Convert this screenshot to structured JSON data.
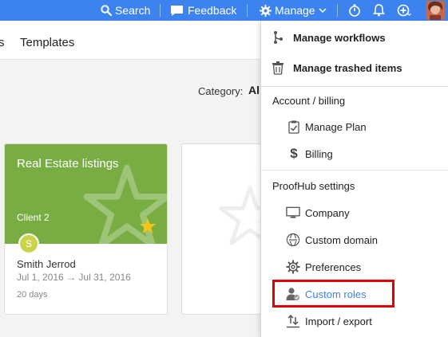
{
  "topbar": {
    "search_label": "Search",
    "feedback_label": "Feedback",
    "manage_label": "Manage",
    "icons": [
      "search-icon",
      "feedback-icon",
      "gear-icon",
      "chevron-down-icon",
      "timer-icon",
      "bell-icon",
      "add-icon"
    ],
    "accent_color": "#3d83f0"
  },
  "subnav": {
    "tabs": [
      "s",
      "Templates"
    ]
  },
  "filter": {
    "category_label": "Category:",
    "category_value": "All"
  },
  "card": {
    "title": "Real Estate listings",
    "client": "Client 2",
    "avatar_initial": "S",
    "owner": "Smith Jerrod",
    "start_date": "Jul 1, 2016",
    "end_date": "Jul 31, 2016",
    "date_arrow": "→",
    "duration": "20 days",
    "header_color": "#78ad43",
    "favorite_color": "#f5c518"
  },
  "menu": {
    "manage_workflows": "Manage workflows",
    "manage_trashed": "Manage trashed items",
    "account_section": "Account / billing",
    "manage_plan": "Manage Plan",
    "billing": "Billing",
    "settings_section": "ProofHub settings",
    "company": "Company",
    "custom_domain": "Custom domain",
    "preferences": "Preferences",
    "custom_roles": "Custom roles",
    "import_export": "Import / export",
    "highlight_color": "#e30000"
  }
}
